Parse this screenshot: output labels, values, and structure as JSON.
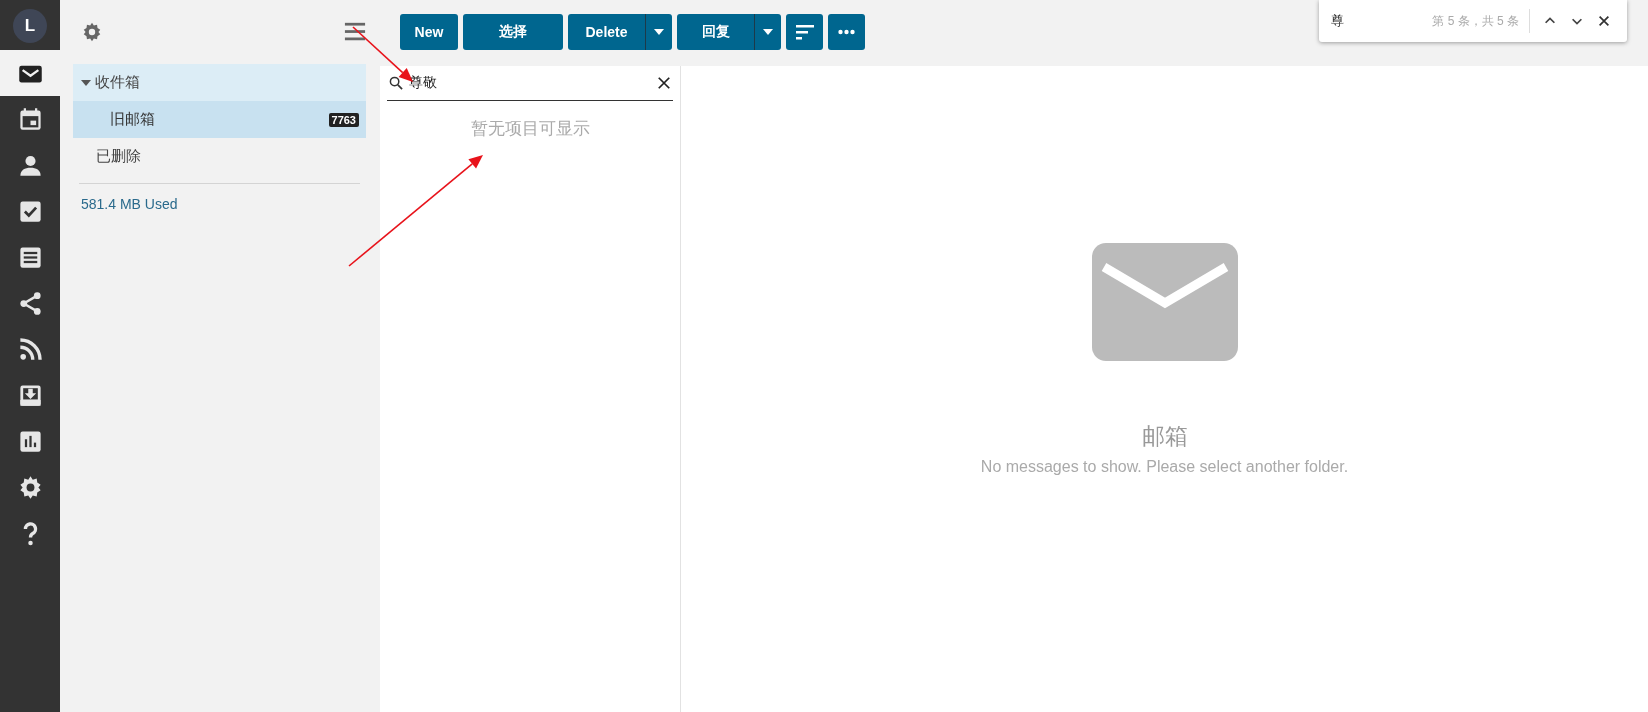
{
  "rail": {
    "avatar": "L",
    "items": [
      {
        "kind": "mail",
        "selected": true
      },
      {
        "kind": "calendar",
        "selected": false
      },
      {
        "kind": "contacts",
        "selected": false
      },
      {
        "kind": "tasks",
        "selected": false
      },
      {
        "kind": "notes",
        "selected": false
      },
      {
        "kind": "share",
        "selected": false
      },
      {
        "kind": "rss",
        "selected": false
      },
      {
        "kind": "download",
        "selected": false
      },
      {
        "kind": "stats",
        "selected": false
      },
      {
        "kind": "settings",
        "selected": false
      },
      {
        "kind": "help",
        "selected": false
      }
    ]
  },
  "folder_panel": {
    "folders": [
      {
        "name": "收件箱",
        "expanded": true,
        "selected": false,
        "children": [
          {
            "name": "旧邮箱",
            "badge": "7763",
            "selected": true
          }
        ]
      },
      {
        "name": "已删除",
        "selected": false
      }
    ],
    "storage": "581.4 MB Used"
  },
  "toolbar": {
    "buttons": [
      {
        "kind": "text",
        "label": "New"
      },
      {
        "kind": "text",
        "label": "选择"
      },
      {
        "kind": "split",
        "label": "Delete"
      },
      {
        "kind": "split",
        "label": "回复"
      },
      {
        "kind": "sort"
      },
      {
        "kind": "more"
      }
    ]
  },
  "message_list": {
    "search": {
      "value": "尊敬"
    },
    "empty": "暂无项目可显示"
  },
  "reading_pane": {
    "title": "邮箱",
    "message": "No messages to show. Please select another folder."
  },
  "find_bar": {
    "query": "尊",
    "count": "第 5 条，共 5 条"
  },
  "annotations": [
    {
      "kind": "arrow"
    },
    {
      "kind": "arrow"
    }
  ]
}
